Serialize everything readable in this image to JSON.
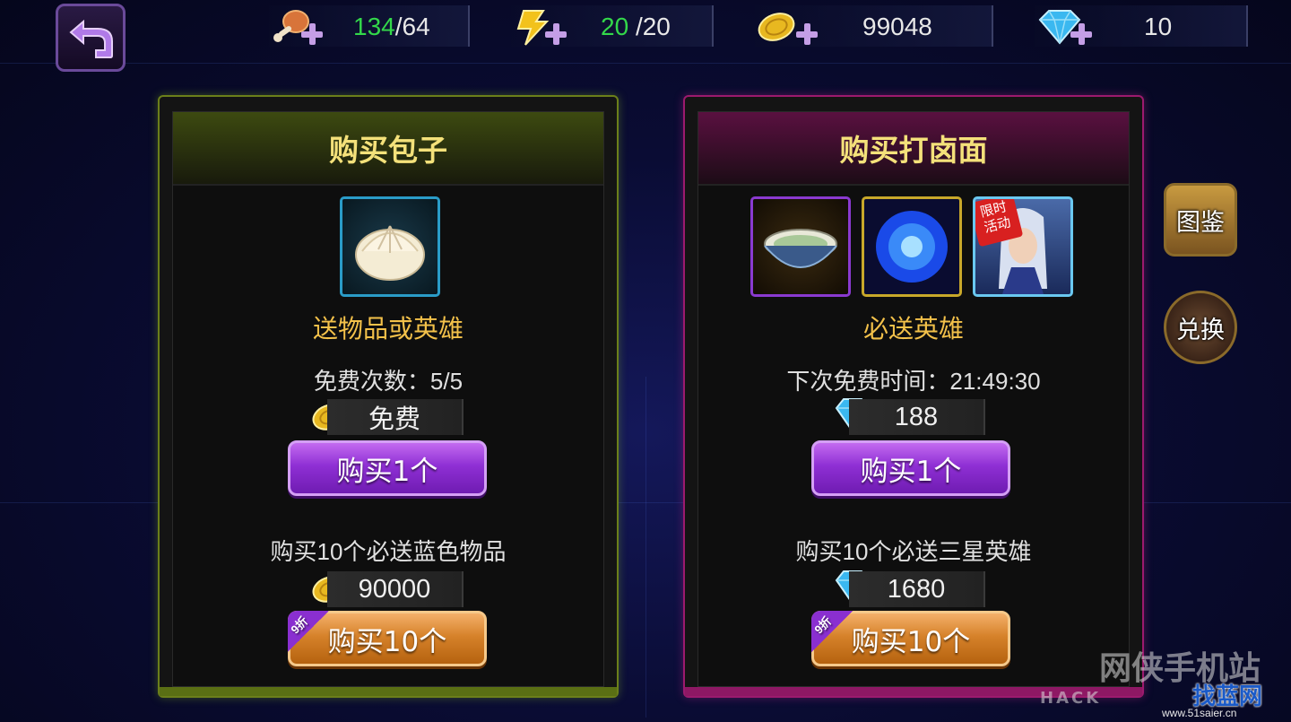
{
  "resources": {
    "stamina": {
      "current": "134",
      "max": "/64",
      "icon": "meat-drumstick-icon"
    },
    "energy": {
      "current": "20",
      "max": "/20",
      "icon": "lightning-icon"
    },
    "gold": {
      "value": "99048",
      "icon": "gold-coin-icon"
    },
    "diamond": {
      "value": "10",
      "icon": "diamond-icon"
    }
  },
  "left_panel": {
    "title": "购买包子",
    "subtitle": "送物品或英雄",
    "free_count": "免费次数：5/5",
    "single_price": "免费",
    "single_button": "购买1个",
    "ten_info": "购买10个必送蓝色物品",
    "ten_price": "90000",
    "ten_button": "购买10个",
    "discount_tag": "9折"
  },
  "right_panel": {
    "title": "购买打卤面",
    "subtitle": "必送英雄",
    "next_free": "下次免费时间：21:49:30",
    "single_price": "188",
    "single_button": "购买1个",
    "ten_info": "购买10个必送三星英雄",
    "ten_price": "1680",
    "ten_button": "购买10个",
    "discount_tag": "9折",
    "hero_badge": "限时活动"
  },
  "side_buttons": {
    "catalog": "图鉴",
    "exchange": "兑换"
  },
  "watermark": {
    "site_name": "网侠手机站",
    "site_url": "HACK",
    "logo_text": "找蓝网",
    "logo_url": "www.51saier.cn"
  },
  "colors": {
    "accent_green": "#33d84a",
    "title_gold": "#f4e17a",
    "subtitle_gold": "#f3c14a",
    "button_purple": "#8f2fd4",
    "button_orange": "#d6822a",
    "panel_left_border": "#6b7f1a",
    "panel_right_border": "#9c1a6e"
  }
}
